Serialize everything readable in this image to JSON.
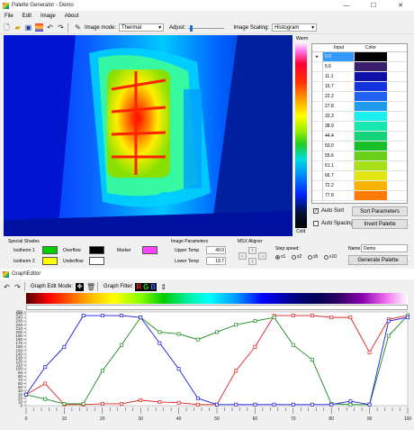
{
  "main_window": {
    "title": "Palette Generator - Demo",
    "menu": [
      "File",
      "Edit",
      "Image",
      "About"
    ],
    "toolbar": {
      "image_mode_label": "Image mode:",
      "image_mode_value": "Thermal",
      "adjust_label": "Adjust:",
      "image_scaling_label": "Image Scaling:",
      "image_scaling_value": "Histogram"
    },
    "scale": {
      "warm_label": "Warm",
      "cold_label": "Cold"
    },
    "table": {
      "headers": [
        "Input",
        "Color"
      ],
      "rows": [
        {
          "input": "0.0",
          "color": "#000000",
          "selected": true
        },
        {
          "input": "5.6",
          "color": "#3b1f6e"
        },
        {
          "input": "11.1",
          "color": "#0f10a8"
        },
        {
          "input": "16.7",
          "color": "#1434dd"
        },
        {
          "input": "22.2",
          "color": "#1f63f0"
        },
        {
          "input": "27.8",
          "color": "#1f9cf0"
        },
        {
          "input": "33.3",
          "color": "#1bf0ee"
        },
        {
          "input": "38.9",
          "color": "#17e8b0"
        },
        {
          "input": "44.4",
          "color": "#13d27a"
        },
        {
          "input": "50.0",
          "color": "#17c029"
        },
        {
          "input": "55.6",
          "color": "#6acf1a"
        },
        {
          "input": "61.1",
          "color": "#a8e018"
        },
        {
          "input": "66.7",
          "color": "#e4e614"
        },
        {
          "input": "72.2",
          "color": "#ffb400"
        },
        {
          "input": "77.8",
          "color": "#ff7a00"
        }
      ]
    },
    "auto_sort_label": "Auto Sort",
    "auto_sort_checked": true,
    "sort_parameters_label": "Sort Parameters",
    "auto_spacing_label": "Auto Spacing",
    "auto_spacing_checked": false,
    "invert_palette_label": "Invert Palette",
    "special_shades": {
      "title": "Special Shades",
      "isotherm1_label": "Isotherm 1",
      "isotherm1_color": "#00d000",
      "isotherm2_label": "Isotherm 2",
      "isotherm2_color": "#ffff00",
      "overflow_label": "Overflow",
      "overflow_color": "#000000",
      "underflow_label": "Underflow",
      "underflow_color": "#ffffff",
      "marker_label": "Marker",
      "marker_color": "#ff44ff"
    },
    "image_parameters": {
      "title": "Image Parameters",
      "upper_temp_label": "Upper Temp",
      "upper_temp_value": "49.0",
      "lower_temp_label": "Lower Temp",
      "lower_temp_value": "19.7"
    },
    "msx_aligner": {
      "title": "MSX Aligner",
      "step_speed_label": "Step speed:",
      "speeds": [
        "x1",
        "x2",
        "x5",
        "x10"
      ],
      "selected_speed": "x1"
    },
    "name_label": "Name",
    "name_value": "Demo",
    "generate_palette_label": "Generate Palette"
  },
  "graph_editor": {
    "title": "GraphEditor",
    "graph_edit_mode_label": "Graph Edit Mode:",
    "graph_filter_label": "Graph Filter:",
    "rgb": [
      "R",
      "G",
      "B"
    ],
    "chart_data": {
      "type": "line",
      "x": [
        0,
        5,
        10,
        15,
        20,
        25,
        30,
        35,
        40,
        45,
        50,
        55,
        60,
        65,
        70,
        75,
        80,
        85,
        90,
        95,
        100
      ],
      "xlim": [
        0,
        100
      ],
      "ylim": [
        0,
        255
      ],
      "y_ticks": [
        0,
        10,
        20,
        30,
        40,
        50,
        60,
        70,
        80,
        90,
        100,
        110,
        120,
        130,
        140,
        150,
        160,
        170,
        180,
        190,
        200,
        210,
        220,
        230,
        240,
        250,
        255
      ],
      "x_ticks": [
        0,
        10,
        20,
        30,
        40,
        50,
        60,
        70,
        80,
        90,
        100
      ],
      "series": [
        {
          "color": "#e02020",
          "values": [
            30,
            60,
            3,
            3,
            5,
            5,
            15,
            10,
            8,
            3,
            3,
            95,
            160,
            245,
            245,
            245,
            240,
            240,
            145,
            235,
            245
          ]
        },
        {
          "color": "#1a8a1a",
          "values": [
            30,
            18,
            5,
            5,
            95,
            165,
            240,
            200,
            195,
            180,
            200,
            220,
            230,
            240,
            165,
            125,
            5,
            3,
            3,
            190,
            245
          ]
        },
        {
          "color": "#1a1ae0",
          "values": [
            30,
            105,
            160,
            245,
            245,
            245,
            240,
            170,
            100,
            20,
            3,
            3,
            3,
            3,
            3,
            3,
            3,
            12,
            3,
            230,
            240
          ]
        }
      ]
    }
  }
}
